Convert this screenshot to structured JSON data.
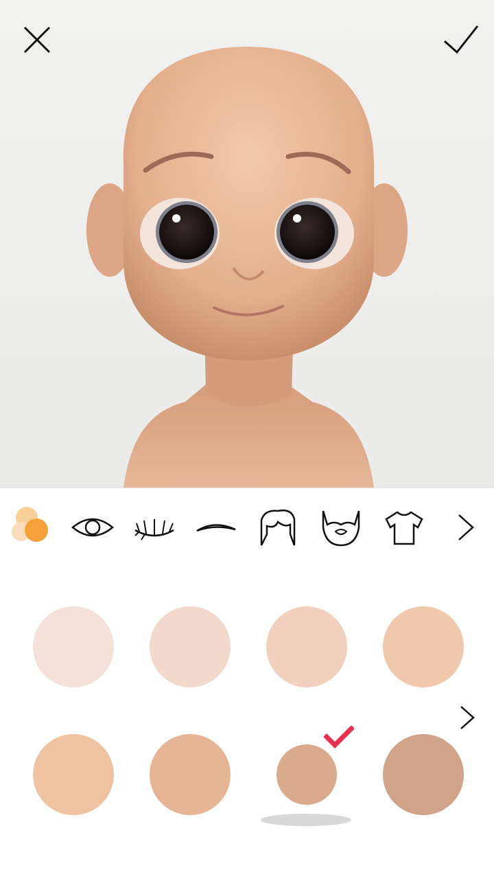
{
  "header": {
    "close_icon": "close-icon",
    "done_icon": "checkmark-icon"
  },
  "colors": {
    "accent_orange": "#f5a23a",
    "selected_check": "#e8304f",
    "background": "#ffffff"
  },
  "tabs": [
    {
      "icon": "skin-color-icon",
      "selected": true
    },
    {
      "icon": "eye-icon",
      "selected": false
    },
    {
      "icon": "eyelashes-icon",
      "selected": false
    },
    {
      "icon": "eyebrow-icon",
      "selected": false
    },
    {
      "icon": "hair-icon",
      "selected": false
    },
    {
      "icon": "beard-icon",
      "selected": false
    },
    {
      "icon": "shirt-icon",
      "selected": false
    },
    {
      "icon": "chevron-right-icon",
      "selected": false
    }
  ],
  "skin_tones": [
    {
      "color": "#f3e1da",
      "selected": false
    },
    {
      "color": "#f2d9cc",
      "selected": false
    },
    {
      "color": "#f1d1bd",
      "selected": false
    },
    {
      "color": "#f0c8ab",
      "selected": false
    },
    {
      "color": "#efc2a2",
      "selected": false
    },
    {
      "color": "#e5b596",
      "selected": false
    },
    {
      "color": "#d9ab8c",
      "selected": true
    },
    {
      "color": "#d1a388",
      "selected": false
    }
  ]
}
